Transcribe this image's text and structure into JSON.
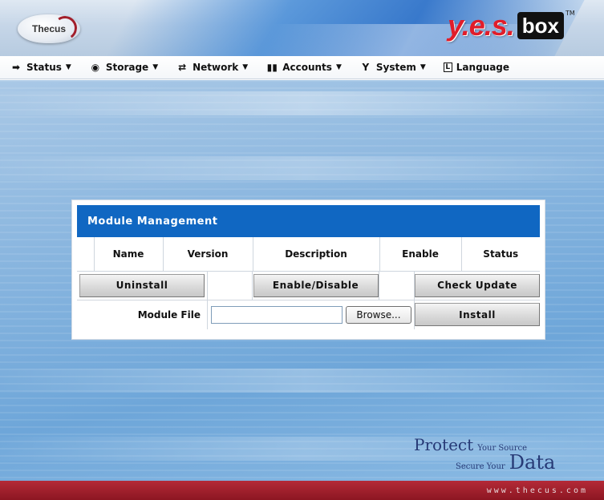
{
  "header": {
    "brand_left": "Thecus",
    "brand_right_yes": "y.e.s.",
    "brand_right_box": "box",
    "trademark": "TM"
  },
  "menu": [
    {
      "label": "Status",
      "icon": "status-icon",
      "glyph": "➡",
      "caret": "▼"
    },
    {
      "label": "Storage",
      "icon": "storage-icon",
      "glyph": "◉",
      "caret": "▼"
    },
    {
      "label": "Network",
      "icon": "network-icon",
      "glyph": "⇄",
      "caret": "▼"
    },
    {
      "label": "Accounts",
      "icon": "accounts-icon",
      "glyph": "▮▮",
      "caret": "▼"
    },
    {
      "label": "System",
      "icon": "system-icon",
      "glyph": "Y",
      "caret": "▼"
    },
    {
      "label": "Language",
      "icon": "language-icon",
      "glyph": "L",
      "caret": ""
    }
  ],
  "module": {
    "title": "Module Management",
    "columns": [
      "",
      "Name",
      "Version",
      "Description",
      "Enable",
      "Status"
    ],
    "uninstall_label": "Uninstall",
    "enable_disable_label": "Enable/Disable",
    "check_update_label": "Check Update",
    "module_file_label": "Module File",
    "module_file_value": "",
    "browse_label": "Browse...",
    "install_label": "Install"
  },
  "watermark": {
    "protect": "Protect",
    "your_source": "Your Source",
    "secure_your": "Secure Your",
    "data": "Data"
  },
  "footer": {
    "url": "www.thecus.com"
  },
  "colors": {
    "panel_header": "#1067c2",
    "footer": "#a21f2b",
    "brand_red": "#e11d2a"
  }
}
